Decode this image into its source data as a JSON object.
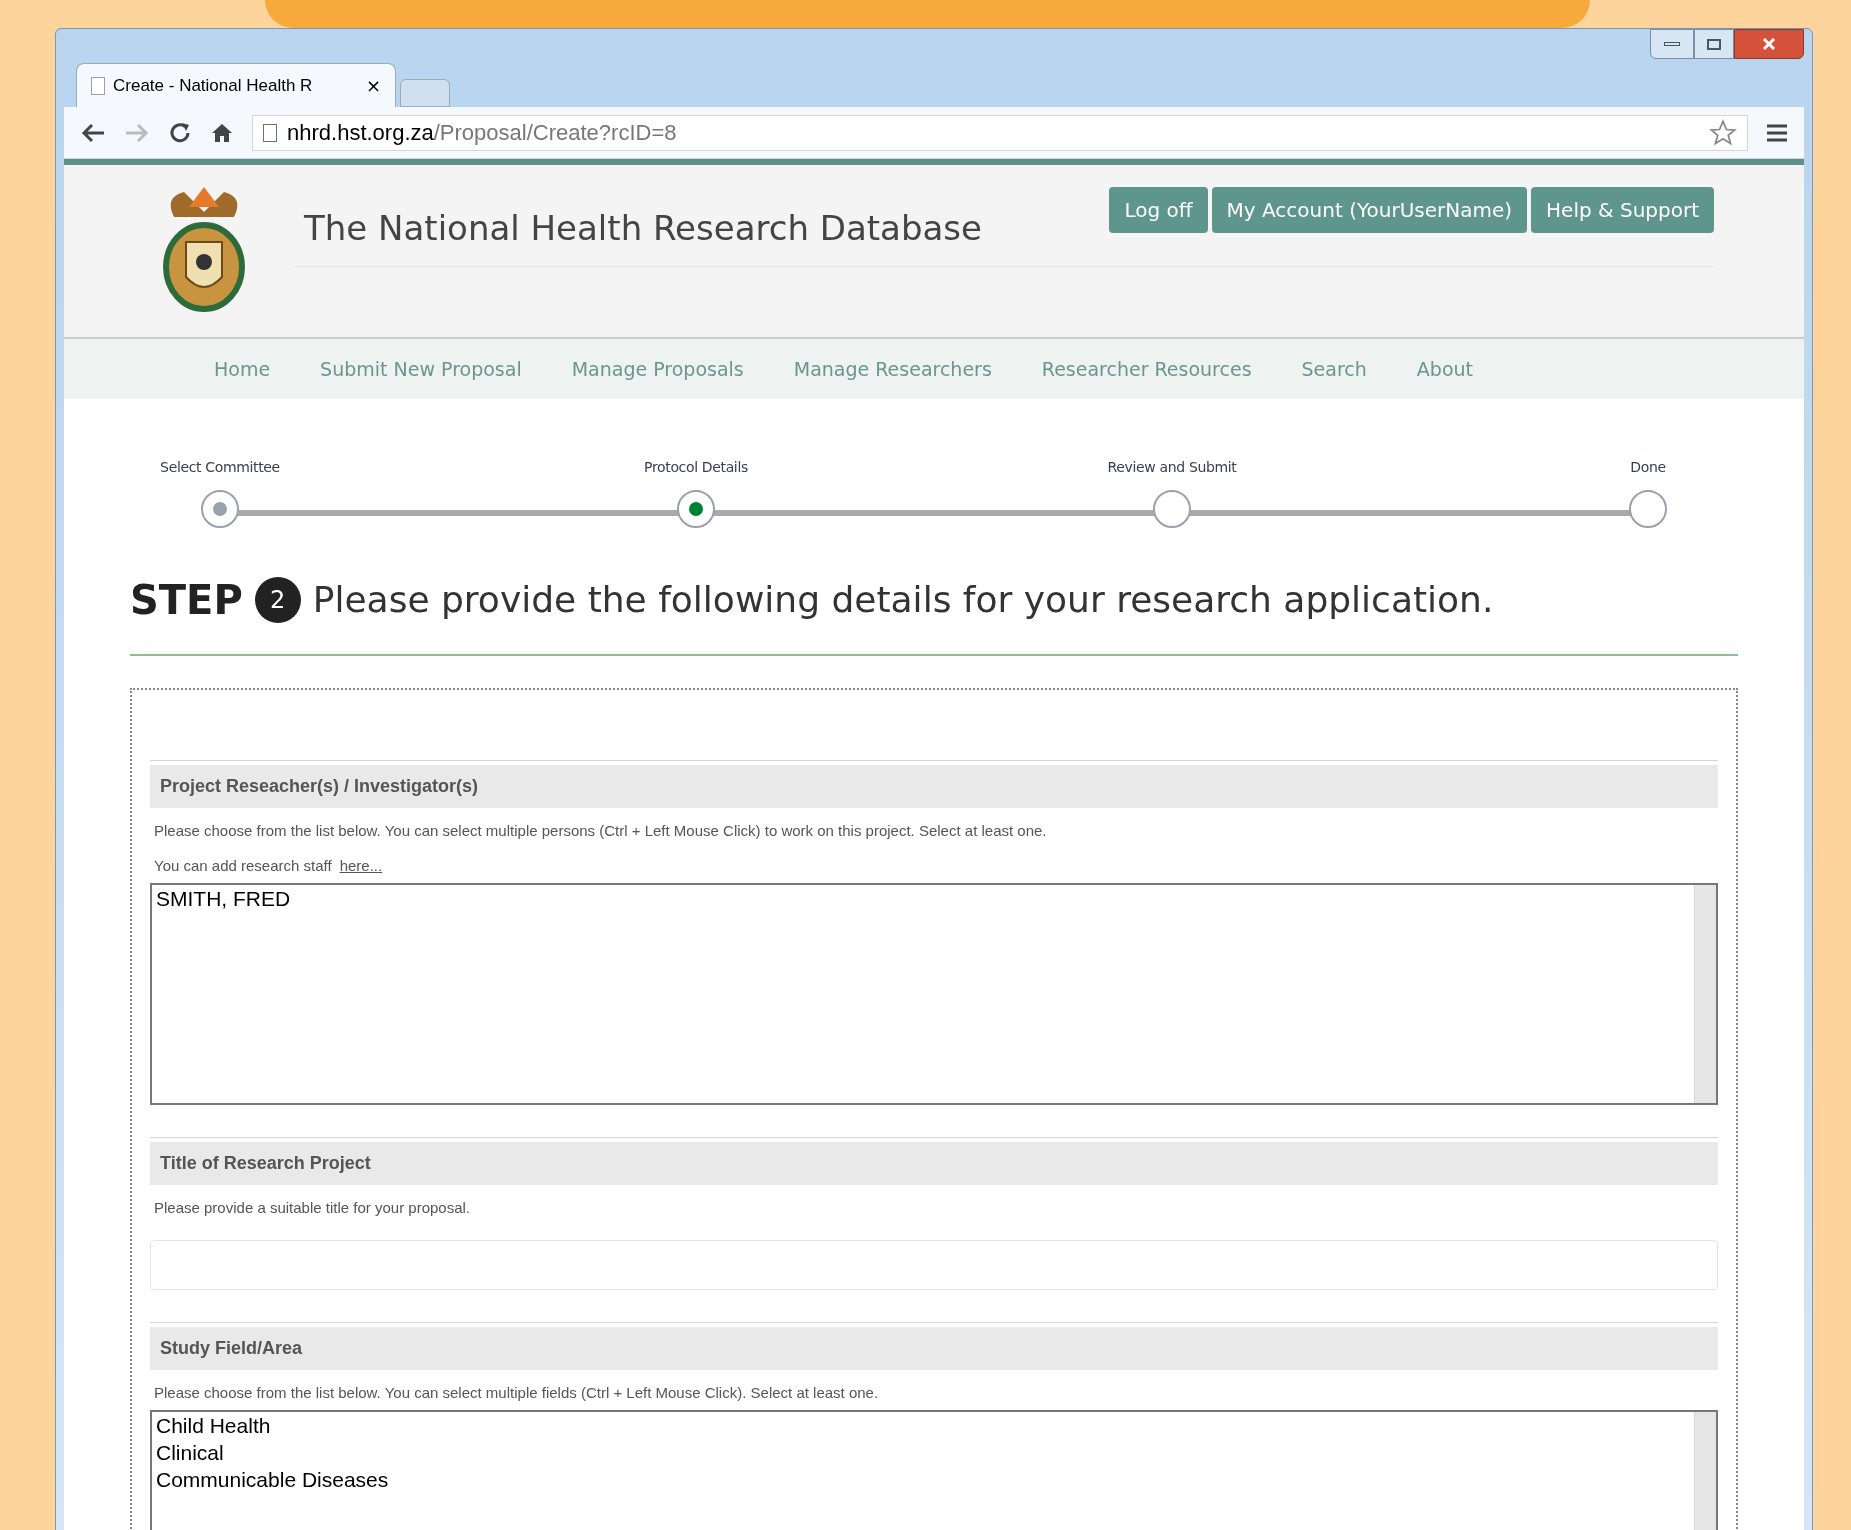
{
  "browser": {
    "tab_title": "Create - National Health R",
    "tab_close": "×",
    "url_host": "nhrd.hst.org.za",
    "url_path": "/Proposal/Create?rcID=8"
  },
  "header": {
    "site_title": "The National Health Research Database",
    "buttons": [
      "Log off",
      "My Account (YourUserName)",
      "Help & Support"
    ]
  },
  "nav": [
    "Home",
    "Submit New Proposal",
    "Manage Proposals",
    "Manage Researchers",
    "Researcher Resources",
    "Search",
    "About"
  ],
  "stepper": [
    {
      "label": "Select Committee",
      "kind": "done"
    },
    {
      "label": "Protocol Details",
      "kind": "current"
    },
    {
      "label": "Review and Submit",
      "kind": "todo"
    },
    {
      "label": "Done",
      "kind": "todo"
    }
  ],
  "step_heading": {
    "word": "STEP",
    "number": "2",
    "text": "Please provide the following details for your research application."
  },
  "sections": [
    {
      "kind": "listbox",
      "title": "Project Reseacher(s) / Investigator(s)",
      "help": "Please choose from the list below. You can select multiple persons (Ctrl + Left Mouse Click) to work on this project. Select at least one.",
      "note": "You can add research staff",
      "link": "here...",
      "options": [
        "SMITH, FRED"
      ]
    },
    {
      "kind": "text",
      "title": "Title of Research Project",
      "help": "Please provide a suitable title for your proposal."
    },
    {
      "kind": "listbox",
      "title": "Study Field/Area",
      "help": "Please choose from the list below. You can select multiple fields (Ctrl + Left Mouse Click). Select at least one.",
      "options": [
        "Child Health",
        "Clinical",
        "Communicable Diseases"
      ]
    }
  ]
}
